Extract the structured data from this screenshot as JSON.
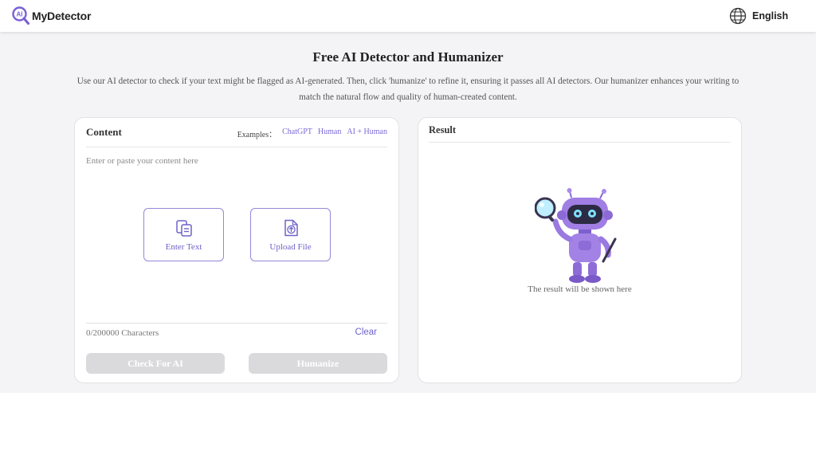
{
  "header": {
    "brand": "MyDetector",
    "logo_icon": "ai-magnifier-logo",
    "language_icon": "globe-icon",
    "language": "English"
  },
  "hero": {
    "title": "Free AI Detector and Humanizer",
    "description": "Use our AI detector to check if your text might be flagged as AI-generated. Then, click 'humanize' to refine it, ensuring it passes all AI detectors. Our humanizer enhances your writing to match the natural flow and quality of human-created content."
  },
  "content_panel": {
    "title": "Content",
    "examples_label": "Examples：",
    "examples": [
      "ChatGPT",
      "Human",
      "AI + Human"
    ],
    "placeholder": "Enter or paste your content here",
    "enter_text": {
      "label": "Enter Text",
      "icon": "clipboard-icon"
    },
    "upload_file": {
      "label": "Upload File",
      "icon": "upload-file-icon"
    },
    "char_count": "0/200000 Characters",
    "clear": "Clear",
    "check_button": "Check For AI",
    "humanize_button": "Humanize"
  },
  "result_panel": {
    "title": "Result",
    "illustration": "robot-magnifier-illustration",
    "empty_text": "The result will be shown here"
  },
  "colors": {
    "accent": "#6e62c8",
    "tile_border": "#9488d8",
    "disabled_button": "#dadadd",
    "band_background": "#f4f4f6"
  }
}
